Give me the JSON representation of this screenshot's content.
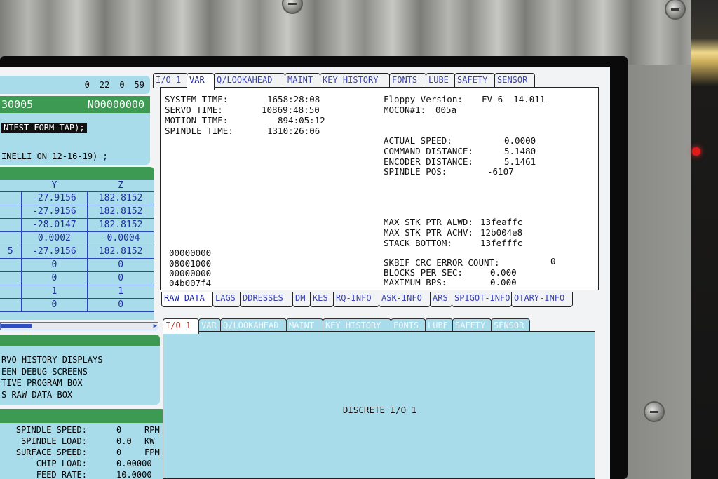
{
  "status": {
    "a": "0",
    "b": "22",
    "c": "0",
    "d": "59"
  },
  "program": {
    "id": "30005",
    "n": "N00000000",
    "line1": "NTEST-FORM-TAP);",
    "line2": "INELLI ON 12-16-19) ;"
  },
  "coords": {
    "headers": [
      "Y",
      "Z"
    ],
    "rows": [
      {
        "m": "",
        "y": "-27.9156",
        "z": "182.8152"
      },
      {
        "m": "",
        "y": "-27.9156",
        "z": "182.8152"
      },
      {
        "m": "",
        "y": "-28.0147",
        "z": "182.8152"
      },
      {
        "m": "",
        "y": "0.0002",
        "z": "-0.0004"
      },
      {
        "m": "5",
        "y": "-27.9156",
        "z": "182.8152"
      },
      {
        "m": "",
        "y": "0",
        "z": "0"
      },
      {
        "m": "",
        "y": "0",
        "z": "0"
      },
      {
        "m": "",
        "y": "1",
        "z": "1"
      },
      {
        "m": "",
        "y": "0",
        "z": "0"
      }
    ]
  },
  "menu": [
    "RVO HISTORY DISPLAYS",
    "EEN DEBUG SCREENS",
    "TIVE PROGRAM BOX",
    "S RAW DATA BOX"
  ],
  "spindle": [
    {
      "label": "SPINDLE SPEED:",
      "value": "0",
      "unit": "RPM"
    },
    {
      "label": "SPINDLE LOAD:",
      "value": "0.0",
      "unit": "KW"
    },
    {
      "label": "SURFACE SPEED:",
      "value": "0",
      "unit": "FPM"
    },
    {
      "label": "CHIP LOAD:",
      "value": "0.00000",
      "unit": ""
    },
    {
      "label": "FEED RATE:",
      "value": "10.0000",
      "unit": ""
    }
  ],
  "top_tabs": [
    "I/O 1",
    "VAR",
    "Q/LOOKAHEAD",
    "MAINT",
    "KEY HISTORY",
    "FONTS",
    "LUBE",
    "SAFETY",
    "SENSOR"
  ],
  "var": {
    "system_time_label": "SYSTEM TIME:",
    "system_time": "1658:28:08",
    "servo_time_label": "SERVO TIME:",
    "servo_time": "10869:48:50",
    "motion_time_label": "MOTION TIME:",
    "motion_time": "894:05:12",
    "spindle_time_label": "SPINDLE TIME:",
    "spindle_time": "1310:26:06",
    "floppy_label": "Floppy Version:",
    "floppy": "FV 6  14.011",
    "mocon_label": "MOCON#1:",
    "mocon": "005a",
    "actual_speed_label": "ACTUAL SPEED:",
    "actual_speed": "0.0000",
    "command_distance_label": "COMMAND DISTANCE:",
    "command_distance": "5.1480",
    "encoder_distance_label": "ENCODER DISTANCE:",
    "encoder_distance": "5.1461",
    "spindle_pos_label": "SPINDLE POS:",
    "spindle_pos": "-6107",
    "max_stk_alwd_label": "MAX STK PTR ALWD:",
    "max_stk_alwd": "13feaffc",
    "max_stk_achv_label": "MAX STK PTR ACHV:",
    "max_stk_achv": "12b004e8",
    "stack_bottom_label": "STACK BOTTOM:",
    "stack_bottom": "13fefffc",
    "crc_label": "SKBIF CRC ERROR COUNT:",
    "crc": "0",
    "blocks_label": "BLOCKS PER SEC:",
    "blocks": "0.000",
    "bps_label": "MAXIMUM BPS:",
    "bps": "0.000",
    "hex": [
      "00000000",
      "08001000",
      "00000000",
      "04b007f4"
    ]
  },
  "raw_tabs": [
    "RAW DATA",
    "LAGS",
    "DDRESSES",
    "DM",
    "KES",
    "RQ-INFO",
    "ASK-INFO",
    "ARS",
    "SPIGOT-INFO",
    "OTARY-INFO"
  ],
  "io_tabs": [
    "I/O 1",
    "VAR",
    "Q/LOOKAHEAD",
    "MAINT",
    "KEY HISTORY",
    "FONTS",
    "LUBE",
    "SAFETY",
    "SENSOR"
  ],
  "io_label": "DISCRETE I/O 1"
}
